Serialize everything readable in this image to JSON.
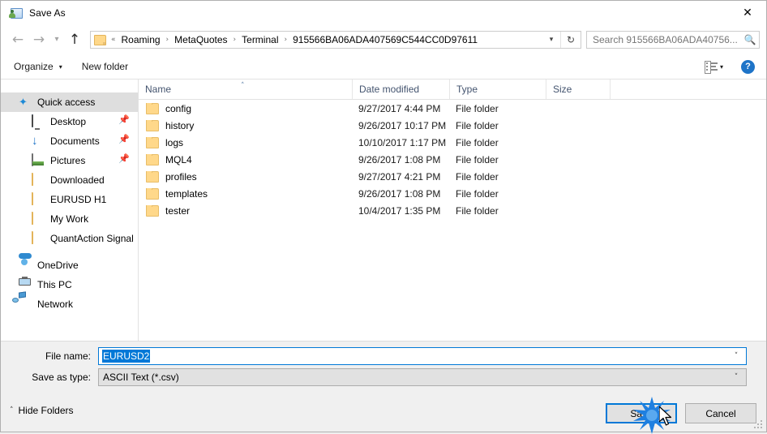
{
  "window": {
    "title": "Save As",
    "title_icon": "save-as-icon",
    "close_icon": "close-icon"
  },
  "nav": {
    "back_icon": "arrow-left-icon",
    "forward_icon": "arrow-right-icon",
    "recent_icon": "chevron-down-icon",
    "up_icon": "arrow-up-icon",
    "folder_icon": "folder-icon",
    "breadcrumb_prefix": "«",
    "breadcrumbs": [
      "Roaming",
      "MetaQuotes",
      "Terminal",
      "915566BA06ADA407569C544CC0D97611"
    ],
    "separator": "›",
    "dropdown_icon": "chevron-down-icon",
    "refresh_icon": "refresh-icon",
    "refresh_glyph": "↻"
  },
  "search": {
    "placeholder": "Search 915566BA06ADA40756...",
    "icon": "search-icon"
  },
  "toolbar": {
    "organize_label": "Organize",
    "organize_caret": "▾",
    "new_folder_label": "New folder",
    "view_icon": "view-layout-icon",
    "view_caret": "▾",
    "help_label": "?",
    "help_icon": "help-icon"
  },
  "sidebar": {
    "items": [
      {
        "label": "Quick access",
        "icon": "star-pin-icon",
        "selected": true,
        "indent": false,
        "pinned": false
      },
      {
        "label": "Desktop",
        "icon": "desktop-icon",
        "selected": false,
        "indent": true,
        "pinned": true
      },
      {
        "label": "Documents",
        "icon": "documents-download-icon",
        "selected": false,
        "indent": true,
        "pinned": true
      },
      {
        "label": "Pictures",
        "icon": "pictures-icon",
        "selected": false,
        "indent": true,
        "pinned": true
      },
      {
        "label": "Downloaded",
        "icon": "folder-icon",
        "selected": false,
        "indent": true,
        "pinned": false
      },
      {
        "label": "EURUSD H1",
        "icon": "folder-icon",
        "selected": false,
        "indent": true,
        "pinned": false
      },
      {
        "label": "My Work",
        "icon": "folder-icon",
        "selected": false,
        "indent": true,
        "pinned": false
      },
      {
        "label": "QuantAction Signal",
        "icon": "folder-icon",
        "selected": false,
        "indent": true,
        "pinned": false
      },
      {
        "label": "OneDrive",
        "icon": "onedrive-icon",
        "selected": false,
        "indent": false,
        "pinned": false
      },
      {
        "label": "This PC",
        "icon": "this-pc-icon",
        "selected": false,
        "indent": false,
        "pinned": false
      },
      {
        "label": "Network",
        "icon": "network-icon",
        "selected": false,
        "indent": false,
        "pinned": false
      }
    ],
    "pin_glyph": "✐"
  },
  "filelist": {
    "columns": [
      {
        "label": "Name",
        "sorted": true,
        "sort_caret": "˄"
      },
      {
        "label": "Date modified",
        "sorted": false
      },
      {
        "label": "Type",
        "sorted": false
      },
      {
        "label": "Size",
        "sorted": false
      }
    ],
    "rows": [
      {
        "name": "config",
        "date": "9/27/2017 4:44 PM",
        "type": "File folder",
        "size": "",
        "icon": "folder-icon"
      },
      {
        "name": "history",
        "date": "9/26/2017 10:17 PM",
        "type": "File folder",
        "size": "",
        "icon": "folder-icon"
      },
      {
        "name": "logs",
        "date": "10/10/2017 1:17 PM",
        "type": "File folder",
        "size": "",
        "icon": "folder-icon"
      },
      {
        "name": "MQL4",
        "date": "9/26/2017 1:08 PM",
        "type": "File folder",
        "size": "",
        "icon": "folder-icon"
      },
      {
        "name": "profiles",
        "date": "9/27/2017 4:21 PM",
        "type": "File folder",
        "size": "",
        "icon": "folder-icon"
      },
      {
        "name": "templates",
        "date": "9/26/2017 1:08 PM",
        "type": "File folder",
        "size": "",
        "icon": "folder-icon"
      },
      {
        "name": "tester",
        "date": "10/4/2017 1:35 PM",
        "type": "File folder",
        "size": "",
        "icon": "folder-icon"
      }
    ]
  },
  "form": {
    "filename_label": "File name:",
    "filename_value": "EURUSD2",
    "filetype_label": "Save as type:",
    "filetype_value": "ASCII Text (*.csv)",
    "combo_caret": "˅"
  },
  "footer": {
    "hide_folders_label": "Hide Folders",
    "hide_folders_caret": "˄",
    "save_label": "Save",
    "cancel_label": "Cancel"
  },
  "colors": {
    "accent": "#0078d7",
    "window_bg": "#ffffff",
    "chrome_bg": "#f0f0f0",
    "selection": "#dedede",
    "folder_yellow": "#ffd88a",
    "column_header_text": "#44546f",
    "burst": "#1e7fe0"
  }
}
